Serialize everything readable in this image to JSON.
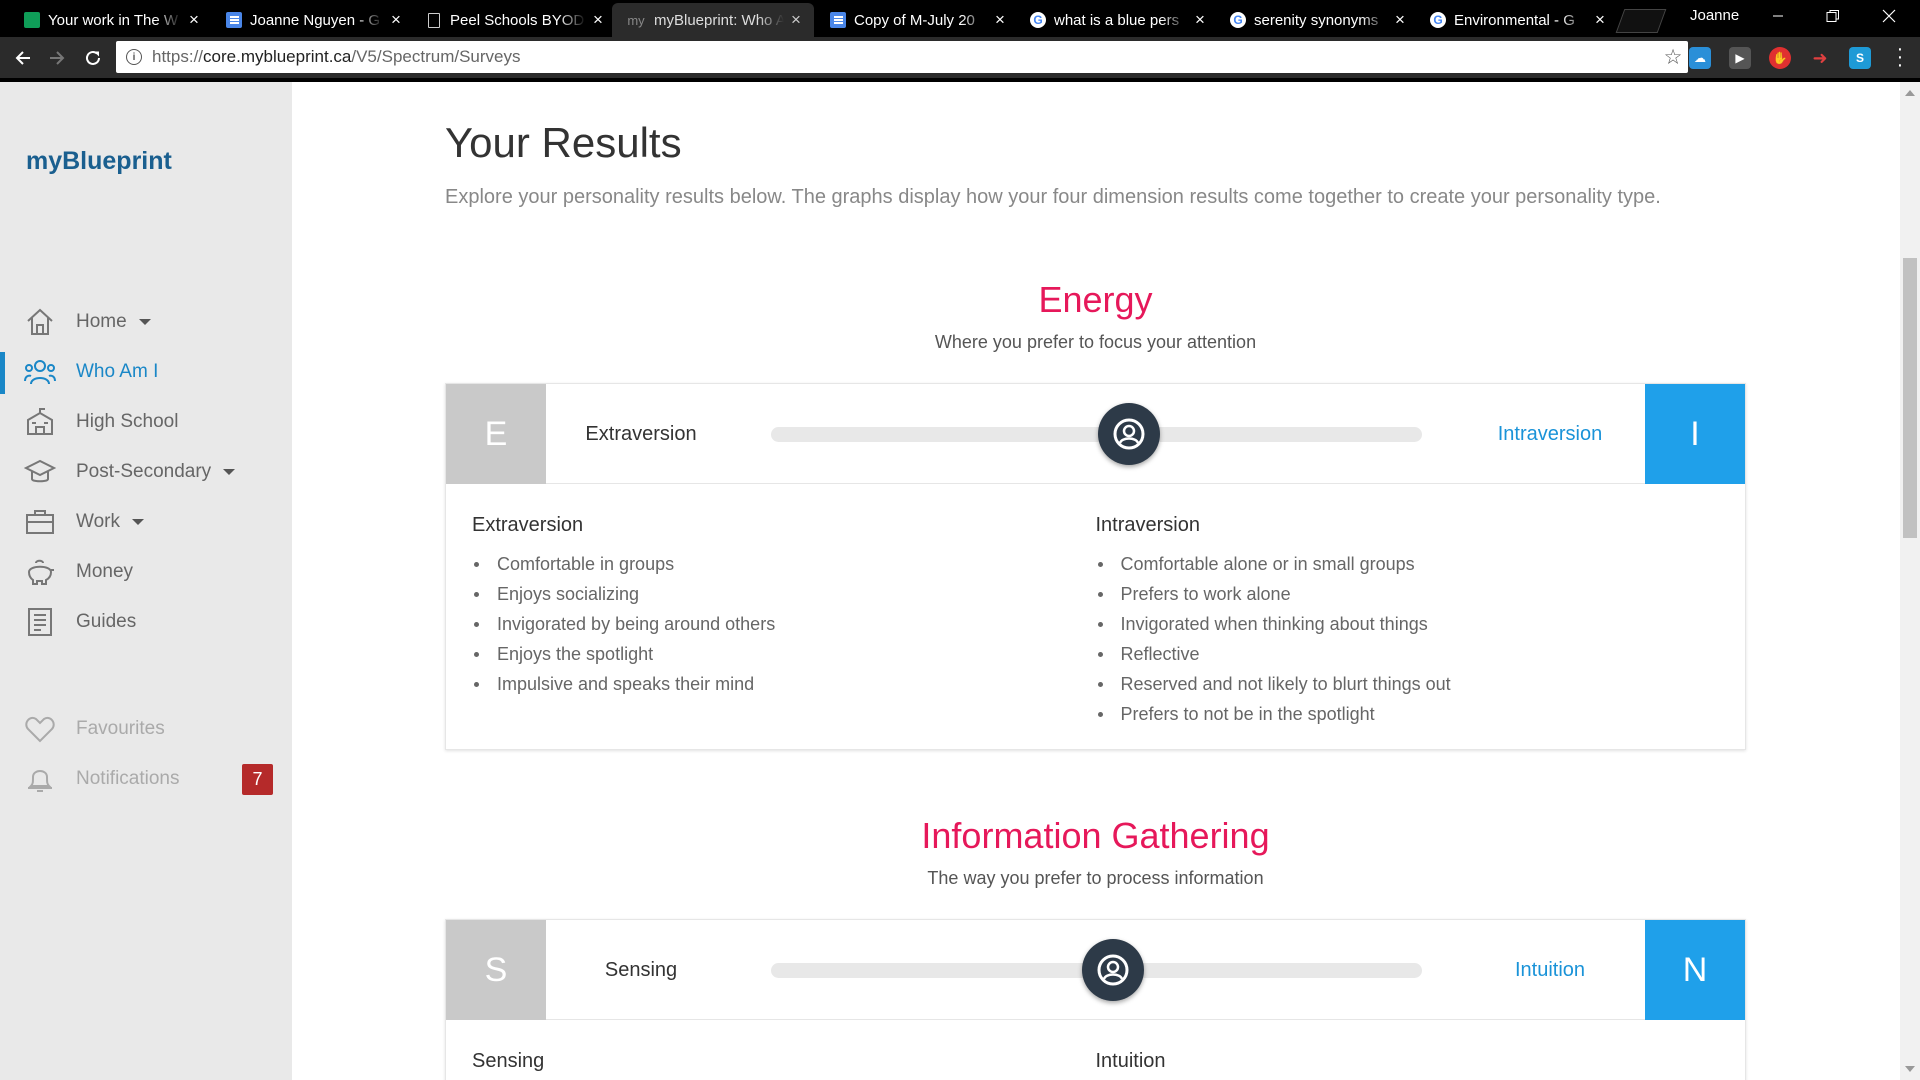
{
  "browser": {
    "tabs": [
      {
        "title": "Your work in The W",
        "icon": "classroom"
      },
      {
        "title": "Joanne Nguyen - G",
        "icon": "doc"
      },
      {
        "title": "Peel Schools BYOD",
        "icon": "page"
      },
      {
        "title": "myBlueprint: Who A",
        "icon": "myblueprint",
        "favicon_text": "my",
        "active": true
      },
      {
        "title": "Copy of M-July 20",
        "icon": "doc"
      },
      {
        "title": "what is a blue pers",
        "icon": "google",
        "favicon_text": "G"
      },
      {
        "title": "serenity synonyms",
        "icon": "google",
        "favicon_text": "G"
      },
      {
        "title": "Environmental - G",
        "icon": "google",
        "favicon_text": "G"
      }
    ],
    "close_glyph": "×",
    "profile_name": "Joanne",
    "url_scheme": "https://",
    "url_host": "core.myblueprint.ca",
    "url_path": "/V5/Spectrum/Surveys"
  },
  "sidebar": {
    "logo": "myBlueprint",
    "items": [
      {
        "label": "Home",
        "icon": "home-icon",
        "dropdown": true
      },
      {
        "label": "Who Am I",
        "icon": "people-icon",
        "active": true
      },
      {
        "label": "High School",
        "icon": "school-icon"
      },
      {
        "label": "Post-Secondary",
        "icon": "graduation-cap-icon",
        "dropdown": true
      },
      {
        "label": "Work",
        "icon": "briefcase-icon",
        "dropdown": true
      },
      {
        "label": "Money",
        "icon": "piggy-bank-icon"
      },
      {
        "label": "Guides",
        "icon": "guide-book-icon"
      }
    ],
    "favourites": "Favourites",
    "notifications": "Notifications",
    "notification_count": "7"
  },
  "main": {
    "title": "Your Results",
    "subtitle": "Explore your personality results below. The graphs display how your four dimension results come together to create your personality type.",
    "sections": [
      {
        "title": "Energy",
        "subtitle": "Where you prefer to focus your attention",
        "left_letter": "E",
        "left_label": "Extraversion",
        "right_label": "Intraversion",
        "right_letter": "I",
        "position_fraction": 0.55,
        "left_heading": "Extraversion",
        "left_traits": [
          "Comfortable in groups",
          "Enjoys socializing",
          "Invigorated by being around others",
          "Enjoys the spotlight",
          "Impulsive and speaks their mind"
        ],
        "right_heading": "Intraversion",
        "right_traits": [
          "Comfortable alone or in small groups",
          "Prefers to work alone",
          "Invigorated when thinking about things",
          "Reflective",
          "Reserved and not likely to blurt things out",
          "Prefers to not be in the spotlight"
        ]
      },
      {
        "title": "Information Gathering",
        "subtitle": "The way you prefer to process information",
        "left_letter": "S",
        "left_label": "Sensing",
        "right_label": "Intuition",
        "right_letter": "N",
        "position_fraction": 0.525,
        "left_heading": "Sensing",
        "right_heading": "Intuition"
      }
    ]
  },
  "colors": {
    "accent_pink": "#e6185a",
    "accent_blue": "#1fa0ea",
    "logo_blue": "#1a5f8f",
    "knob_dark": "#2d3a48",
    "badge_red": "#b52a2a"
  }
}
